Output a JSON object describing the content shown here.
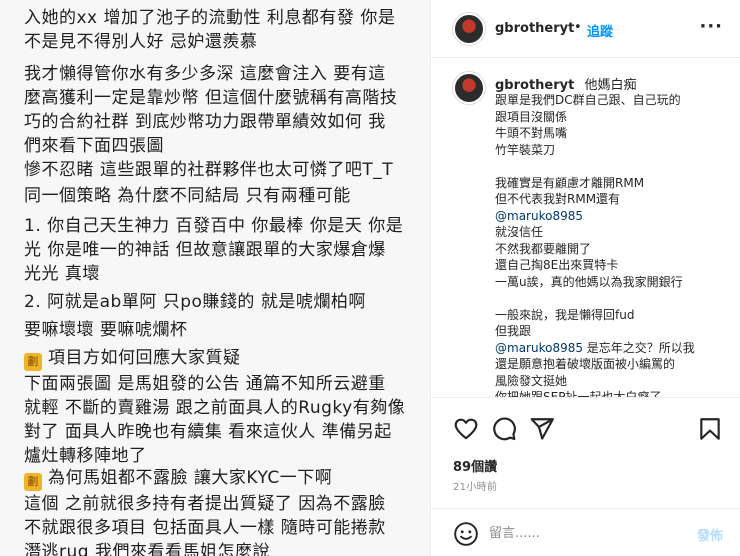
{
  "post_image": {
    "paragraphs": [
      {
        "icon": "",
        "lines": [
          "入她的xx 增加了池子的流動性 利息都有發 你是",
          "不是見不得別人好 忌妒還羨慕"
        ]
      },
      {
        "icon": "",
        "lines": [
          "我才懶得管你水有多少多深 這麼會注入 要有這",
          "麼高獲利一定是靠炒幣 但這個什麼號稱有高階技",
          "巧的合約社群 到底炒幣功力跟帶單績效如何 我",
          "們來看下面四張圖"
        ]
      },
      {
        "icon": "",
        "lines": [
          "慘不忍睹 這些跟單的社群夥伴也太可憐了吧T_T"
        ]
      },
      {
        "icon": "",
        "lines": [
          "同一個策略 為什麼不同結局 只有兩種可能"
        ]
      },
      {
        "icon": "",
        "lines": [
          "1. 你自己天生神力 百發百中 你最棒 你是天 你是",
          "光 你是唯一的神話 但故意讓跟單的大家爆倉爆",
          "光光 真壞"
        ]
      },
      {
        "icon": "",
        "lines": [
          "2. 阿就是ab單阿 只po賺錢的 就是唬爛柏啊"
        ]
      },
      {
        "icon": "",
        "lines": [
          "要嘛壞壞 要嘛唬爛杯"
        ]
      },
      {
        "icon": "劃",
        "lines": [
          "項目方如何回應大家質疑"
        ]
      },
      {
        "icon": "",
        "lines": [
          "下面兩張圖 是馬姐發的公告 通篇不知所云避重",
          "就輕 不斷的賣雞湯 跟之前面具人的Rugky有夠像",
          "對了 面具人昨晚也有續集 看來這伙人 準備另起",
          "爐灶轉移陣地了"
        ]
      },
      {
        "icon": "劃",
        "lines": [
          "為何馬姐都不露臉 讓大家KYC一下啊"
        ]
      },
      {
        "icon": "",
        "lines": [
          "這個 之前就很多持有者提出質疑了 因為不露臉",
          "不就跟很多項目 包括面具人一樣 隨時可能捲款",
          "潛逃rug 我們來看看馬姐怎麼說"
        ]
      }
    ]
  },
  "header": {
    "username": "gbrotheryt",
    "separator": "•",
    "follow_label": "追蹤",
    "more_label": "···"
  },
  "caption": {
    "username": "gbrotheryt",
    "first_text": "他媽白痴",
    "lines": [
      "跟單是我們DC群自己跟、自己玩的",
      "跟項目沒關係",
      "牛頭不對馬嘴",
      "竹竿裝菜刀",
      "",
      "我確實是有顧慮才離開RMM",
      "但不代表我對RMM還有",
      "@maruko8985",
      "就沒信任",
      "不然我都要離開了",
      "還自己掏8E出來買特卡",
      "一萬u誒，真的他媽以為我家開銀行",
      "",
      "一般來說，我是懶得回fud",
      "但我跟",
      "@maruko8985 是忘年之交？所以我",
      "還是願意抱着破壞版面被小編罵的",
      "風險發文挺她",
      "你把她跟SEP扯一起也太白癡了"
    ]
  },
  "engagement": {
    "likes": "89個讚",
    "time": "21小時前"
  },
  "comment": {
    "placeholder": "留言......",
    "post_label": "發佈"
  },
  "icons": {
    "like": "heart-icon",
    "comment": "comment-icon",
    "share": "send-icon",
    "save": "bookmark-icon",
    "emoji": "smiley-icon"
  },
  "colors": {
    "accent": "#0095f6",
    "mention": "#00376b",
    "muted": "#8e8e8e"
  }
}
